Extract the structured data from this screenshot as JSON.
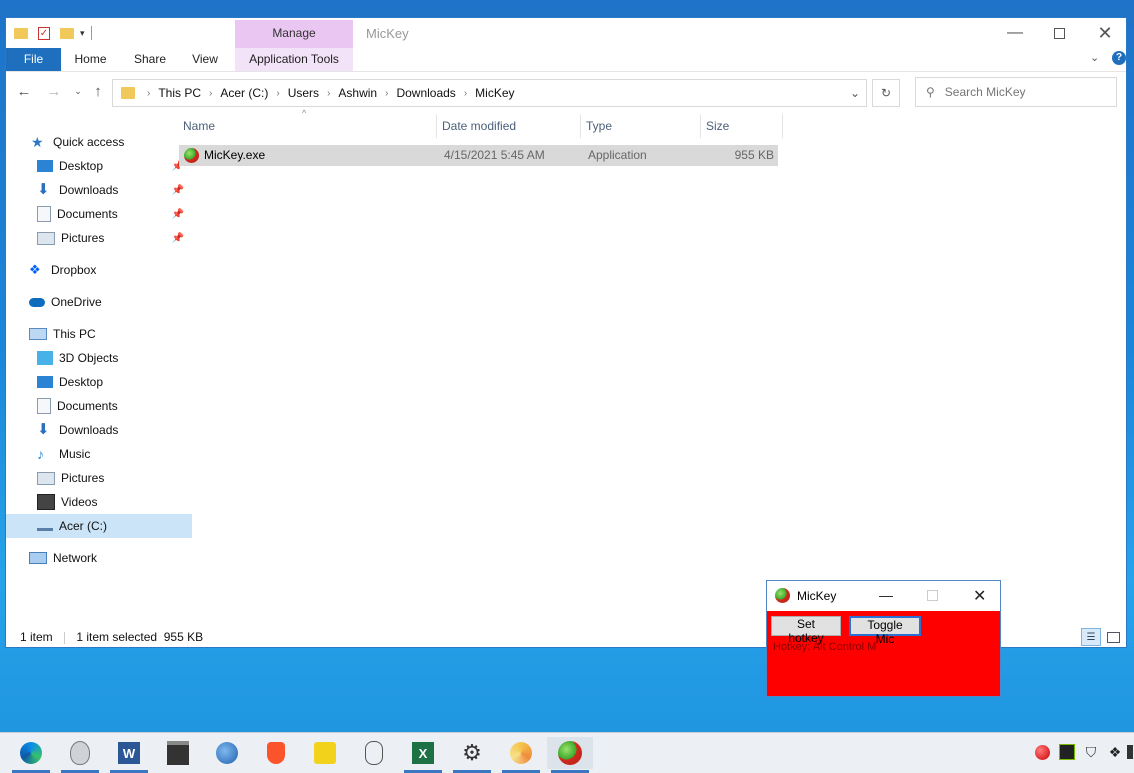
{
  "explorer": {
    "title": "MicKey",
    "context_tab": "Manage",
    "ribbon_tabs": [
      "File",
      "Home",
      "Share",
      "View",
      "Application Tools"
    ],
    "breadcrumb": [
      "This PC",
      "Acer (C:)",
      "Users",
      "Ashwin",
      "Downloads",
      "MicKey"
    ],
    "search_placeholder": "Search MicKey",
    "sidebar": [
      {
        "label": "Quick access"
      },
      {
        "label": "Desktop",
        "pinned": true
      },
      {
        "label": "Downloads",
        "pinned": true
      },
      {
        "label": "Documents",
        "pinned": true
      },
      {
        "label": "Pictures",
        "pinned": true
      },
      {
        "label": "Dropbox"
      },
      {
        "label": "OneDrive"
      },
      {
        "label": "This PC"
      },
      {
        "label": "3D Objects"
      },
      {
        "label": "Desktop"
      },
      {
        "label": "Documents"
      },
      {
        "label": "Downloads"
      },
      {
        "label": "Music"
      },
      {
        "label": "Pictures"
      },
      {
        "label": "Videos"
      },
      {
        "label": "Acer (C:)",
        "selected": true
      },
      {
        "label": "Network"
      }
    ],
    "columns": [
      "Name",
      "Date modified",
      "Type",
      "Size"
    ],
    "files": [
      {
        "name": "MicKey.exe",
        "date": "4/15/2021 5:45 AM",
        "type": "Application",
        "size": "955 KB"
      }
    ],
    "status": {
      "count": "1 item",
      "selected": "1 item selected  955 KB"
    }
  },
  "mickey": {
    "title": "MicKey",
    "set_hotkey": "Set hotkey",
    "toggle_mic": "Toggle Mic",
    "hotkey_text": "Hotkey: Alt Control M",
    "bg_color": "#ff0000"
  },
  "taskbar": {
    "icons": [
      "edge-icon",
      "alien-icon",
      "word-icon",
      "clapperboard-icon",
      "thunderbird-icon",
      "brave-icon",
      "player-icon",
      "tool-icon",
      "excel-icon",
      "settings-icon",
      "pinwheel-icon",
      "mickey-icon"
    ],
    "tray": [
      "mickey-tray-icon",
      "nvidia-icon",
      "shield-icon",
      "dropbox-icon",
      "more-icon"
    ]
  }
}
